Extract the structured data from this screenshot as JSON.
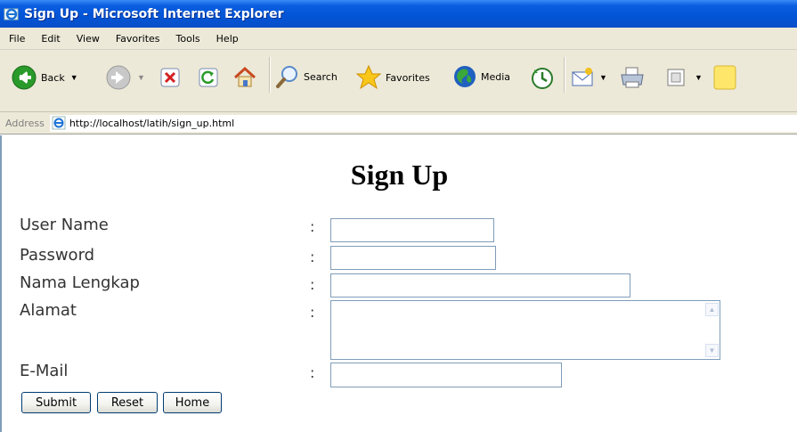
{
  "window": {
    "title": "Sign Up - Microsoft Internet Explorer"
  },
  "menu": [
    "File",
    "Edit",
    "View",
    "Favorites",
    "Tools",
    "Help"
  ],
  "toolbar": {
    "back_label": "Back",
    "search_label": "Search",
    "favorites_label": "Favorites",
    "media_label": "Media"
  },
  "address": {
    "label": "Address",
    "url": "http://localhost/latih/sign_up.html"
  },
  "page": {
    "title": "Sign Up",
    "colon": ":",
    "fields": {
      "username_label": "User Name",
      "password_label": "Password",
      "fullname_label": "Nama Lengkap",
      "address_label": "Alamat",
      "email_label": "E-Mail"
    },
    "buttons": {
      "submit": "Submit",
      "reset": "Reset",
      "home": "Home"
    }
  }
}
